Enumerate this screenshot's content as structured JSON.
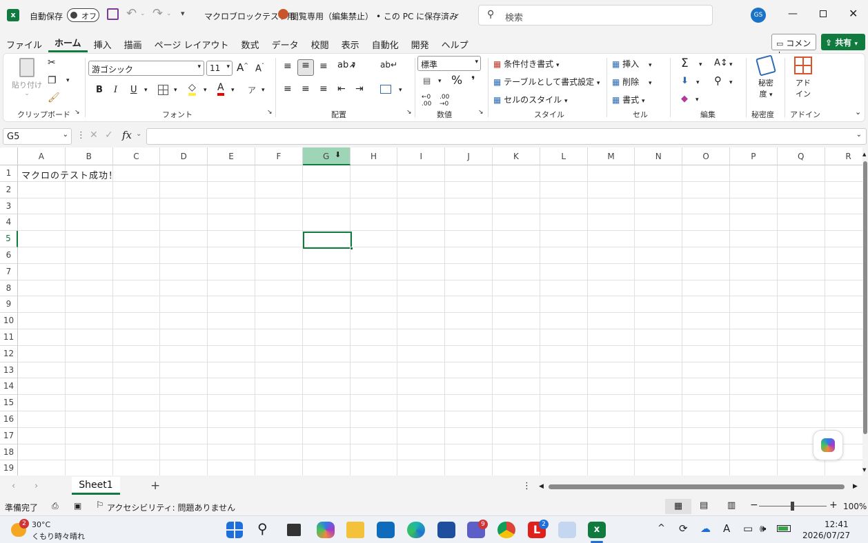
{
  "titlebar": {
    "autosave_label": "自動保存",
    "autosave_state": "オフ",
    "filename": "マクロブロックテスト用",
    "readonly_status": "閲覧専用（編集禁止）",
    "save_location": "• この PC に保存済み",
    "search_placeholder": "検索",
    "avatar_initials": "GS"
  },
  "menu": {
    "tabs": [
      "ファイル",
      "ホーム",
      "挿入",
      "描画",
      "ページ レイアウト",
      "数式",
      "データ",
      "校閲",
      "表示",
      "自動化",
      "開発",
      "ヘルプ"
    ],
    "active_tab": "ホーム",
    "comment_label": "コメント",
    "share_label": "共有"
  },
  "ribbon": {
    "clipboard": {
      "paste_label": "貼り付け",
      "group_label": "クリップボード"
    },
    "font": {
      "font_name": "游ゴシック",
      "font_size": "11",
      "group_label": "フォント",
      "bold": "B",
      "italic": "I",
      "underline": "U"
    },
    "alignment": {
      "group_label": "配置"
    },
    "number": {
      "format": "標準",
      "percent": "%",
      "group_label": "数値"
    },
    "styles": {
      "conditional": "条件付き書式",
      "table": "テーブルとして書式設定",
      "cell_styles": "セルのスタイル",
      "group_label": "スタイル"
    },
    "cells": {
      "insert": "挿入",
      "delete": "削除",
      "format": "書式",
      "group_label": "セル"
    },
    "editing": {
      "group_label": "編集"
    },
    "sensitivity": {
      "label1": "秘密",
      "label2": "度",
      "group_label": "秘密度"
    },
    "addins": {
      "label1": "アド",
      "label2": "イン",
      "group_label": "アドイン"
    }
  },
  "formula_bar": {
    "name_box": "G5",
    "fx": "fx",
    "content": ""
  },
  "grid": {
    "columns": [
      "A",
      "B",
      "C",
      "D",
      "E",
      "F",
      "G",
      "H",
      "I",
      "J",
      "K",
      "L",
      "M",
      "N",
      "O",
      "P",
      "Q",
      "R"
    ],
    "rows": [
      "1",
      "2",
      "3",
      "4",
      "5",
      "6",
      "7",
      "8",
      "9",
      "10",
      "11",
      "12",
      "13",
      "14",
      "15",
      "16",
      "17",
      "18",
      "19"
    ],
    "selected_column": "G",
    "selected_row": "5",
    "cell_A1": "マクロのテスト成功！"
  },
  "sheets": {
    "tabs": [
      "Sheet1"
    ],
    "add_label": "+"
  },
  "status": {
    "ready": "準備完了",
    "accessibility": "アクセシビリティ: 問題ありません",
    "zoom": "100%"
  },
  "taskbar": {
    "weather_temp": "30°C",
    "weather_desc": "くもり時々晴れ",
    "weather_badge": "2",
    "teams_badge": "9",
    "l_badge": "2",
    "time": "12:41",
    "date": "2026/07/27"
  },
  "colors": {
    "accent": "#117a3e",
    "selected_header": "#9fd5b7",
    "avatar": "#1a73c7"
  }
}
